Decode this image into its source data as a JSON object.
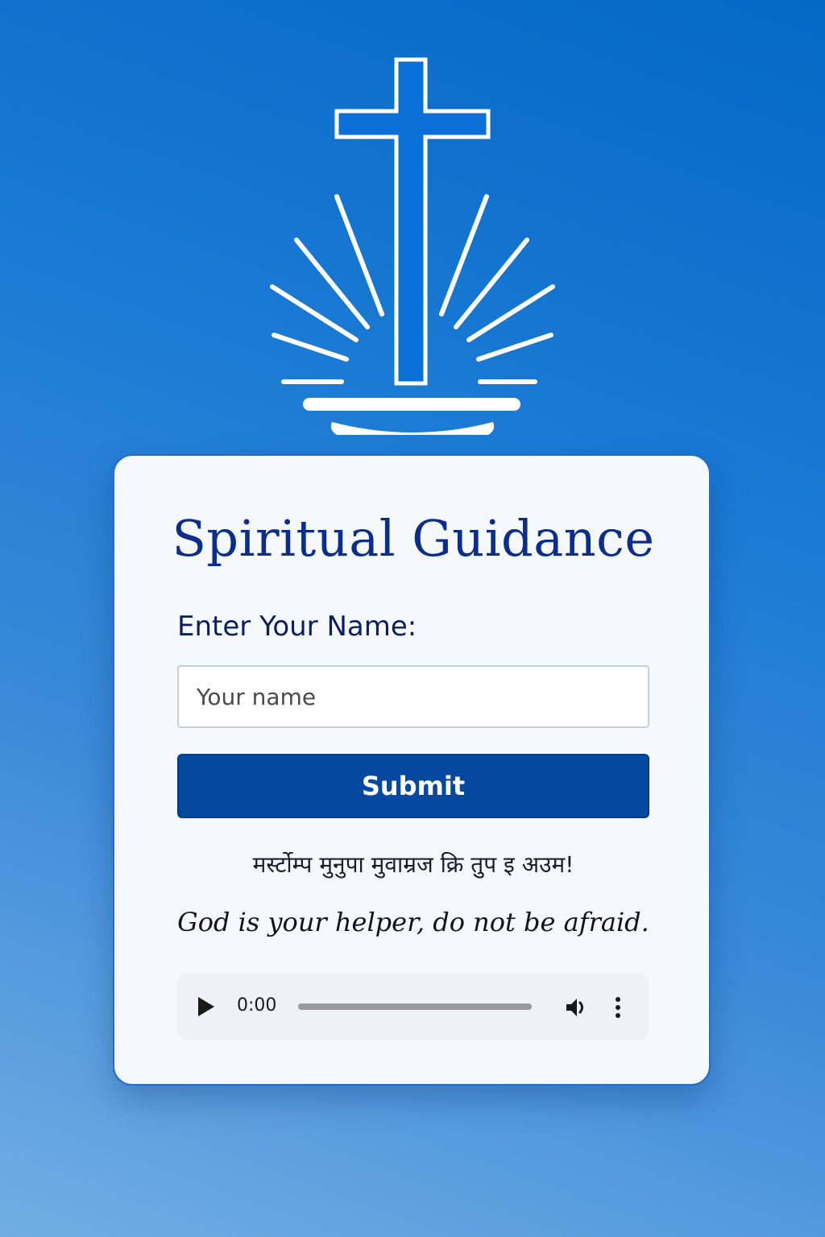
{
  "form": {
    "title": "Spiritual Guidance",
    "name_label": "Enter Your Name:",
    "name_placeholder": "Your name",
    "name_value": "",
    "submit_label": "Submit"
  },
  "message": {
    "hindi_text": "मर्स्टोम्प मुनुपा मुवाम्रज क्रि तुुप इ अउम!",
    "verse": "God is your helper, do not be afraid."
  },
  "audio": {
    "current_time": "0:00",
    "progress": 0
  },
  "icons": {
    "emblem": "cross-with-rays-icon",
    "play": "play-icon",
    "volume": "volume-icon",
    "more": "more-vertical-icon"
  },
  "colors": {
    "background": "#0468c6",
    "card": "#f5f9fd",
    "title": "#0a2e8a",
    "button": "#0448a0",
    "emblem_fill": "#0a6fd6",
    "emblem_stroke": "#ffffff"
  }
}
